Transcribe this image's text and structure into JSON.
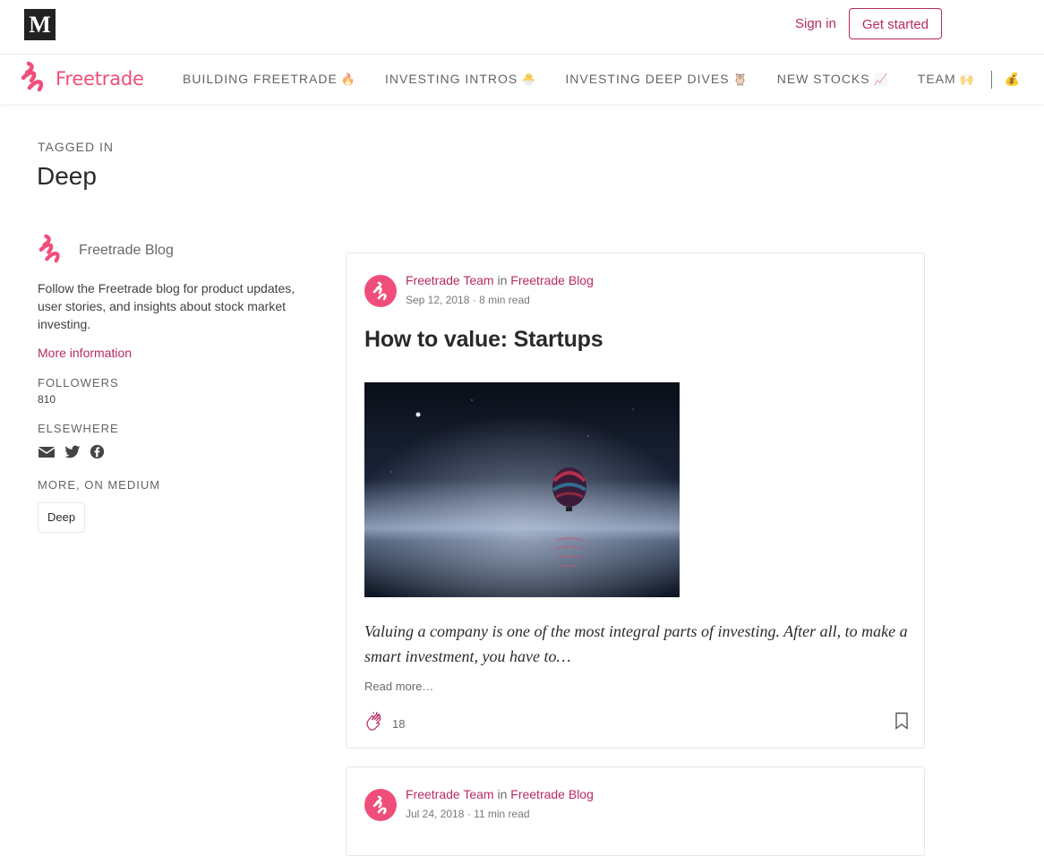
{
  "topbar": {
    "logo": "M",
    "sign_in": "Sign in",
    "get_started": "Get started"
  },
  "pubnav": {
    "brand": "Freetrade",
    "items": [
      {
        "label": "BUILDING FREETRADE",
        "emoji": "🔥"
      },
      {
        "label": "INVESTING INTROS",
        "emoji": "🐣"
      },
      {
        "label": "INVESTING DEEP DIVES",
        "emoji": "🦉"
      },
      {
        "label": "NEW STOCKS",
        "emoji": "📈"
      },
      {
        "label": "TEAM",
        "emoji": "🙌"
      }
    ],
    "more_emoji": "💰"
  },
  "tag": {
    "tagged_in": "TAGGED IN",
    "name": "Deep"
  },
  "sidebar": {
    "publication": "Freetrade Blog",
    "description": "Follow the Freetrade blog for product updates, user stories, and insights about stock market investing.",
    "more_info": "More information",
    "followers_label": "FOLLOWERS",
    "followers": "810",
    "elsewhere_label": "ELSEWHERE",
    "social_icons": [
      "email-icon",
      "twitter-icon",
      "facebook-icon"
    ],
    "more_on_medium": "MORE, ON MEDIUM",
    "tag_chip": "Deep"
  },
  "posts": [
    {
      "author": "Freetrade Team",
      "in": "in",
      "publication": "Freetrade Blog",
      "date": "Sep 12, 2018",
      "read_time": "8 min read",
      "title": "How to value: Startups",
      "excerpt": "Valuing a company is one of the most integral parts of investing. After all, to make a smart investment, you have to…",
      "read_more": "Read more…",
      "claps": "18"
    },
    {
      "author": "Freetrade Team",
      "in": "in",
      "publication": "Freetrade Blog",
      "date": "Jul 24, 2018",
      "read_time": "11 min read"
    }
  ],
  "colors": {
    "accent": "#b72a63",
    "brand": "#f04e7a"
  }
}
